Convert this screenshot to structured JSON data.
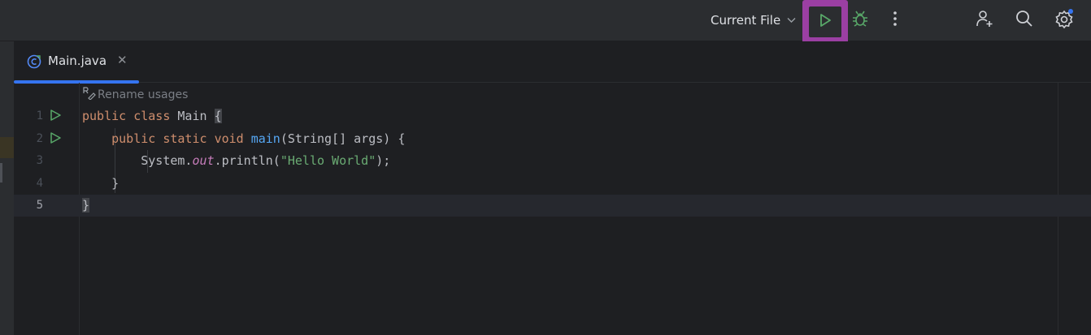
{
  "toolbar": {
    "run_config": "Current File",
    "run_tooltip": "Run",
    "debug_tooltip": "Debug"
  },
  "tabs": [
    {
      "label": "Main.java",
      "active": true
    }
  ],
  "editor": {
    "inlay_hint": "Rename usages",
    "lines": [
      {
        "num": "1"
      },
      {
        "num": "2"
      },
      {
        "num": "3"
      },
      {
        "num": "4"
      },
      {
        "num": "5"
      }
    ],
    "code": {
      "l1_kw1": "public",
      "l1_kw2": "class",
      "l1_name": "Main",
      "l1_brace": "{",
      "l2_kw1": "public",
      "l2_kw2": "static",
      "l2_kw3": "void",
      "l2_fn": "main",
      "l2_params": "(String[] args) {",
      "l3_sys": "System.",
      "l3_out": "out",
      "l3_println": ".println(",
      "l3_str": "\"Hello World\"",
      "l3_end": ");",
      "l4": "}",
      "l5": "}"
    }
  },
  "colors": {
    "accent": "#3574f0",
    "highlight_border": "#9b3fa3",
    "run_green": "#59a869"
  }
}
